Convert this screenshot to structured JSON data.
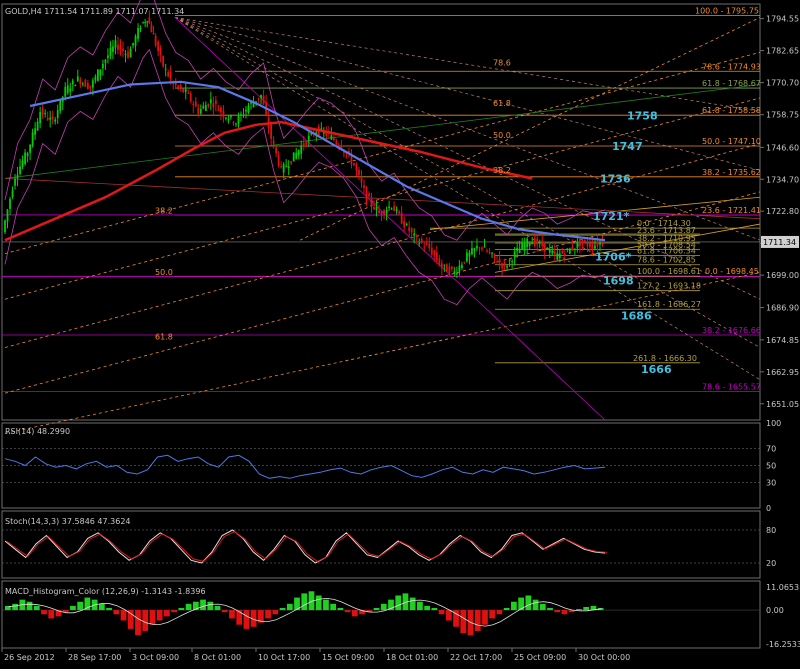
{
  "colors": {
    "background": "#000000",
    "frame": "#6e6e6e",
    "text": "#c8c8c8",
    "bull_candle": "#00d000",
    "bear_candle": "#e01010",
    "ma_red": "#e01818",
    "ma_blue": "#5a78e8",
    "bollinger": "#c040b0",
    "fib_orange": "#f08a2a",
    "fib_magenta": "#c000c0",
    "fib_olive": "#b0a040",
    "target_cyan": "#40c0e0",
    "rsi_line": "#4a7ae8",
    "stoch_main": "#e0e0e0",
    "stoch_signal": "#e01818",
    "macd_up": "#20d020",
    "macd_down": "#e01010"
  },
  "main": {
    "header": "GOLD,H4  1711.54 1711.89 1711.07 1711.34",
    "price_tag": "1711.34",
    "y_axis_ticks": [
      "1794.55",
      "1782.65",
      "1770.70",
      "1758.75",
      "1746.60",
      "1734.70",
      "1722.80",
      "1710.85",
      "1699.00",
      "1686.90",
      "1674.85",
      "1662.95",
      "1651.05"
    ],
    "fib_labels": [
      {
        "text": "100.0 - 1795.75",
        "kind": "orange"
      },
      {
        "text": "78.6 - 1774.93",
        "kind": "orange"
      },
      {
        "text": "61.8 - 1768.67",
        "kind": "green"
      },
      {
        "text": "61.8 - 1758.58",
        "kind": "orange"
      },
      {
        "text": "50.0 - 1747.10",
        "kind": "orange"
      },
      {
        "text": "38.2 - 1735.62",
        "kind": "orange"
      },
      {
        "text": "23.6 - 1721.41",
        "kind": "orange"
      },
      {
        "text": "0.0 - 1714.30",
        "kind": "olive"
      },
      {
        "text": "23.6 - 1713.87",
        "kind": "olive"
      },
      {
        "text": "38.2 - 1710.95",
        "kind": "olive"
      },
      {
        "text": "50.0 - 1708.54",
        "kind": "olive"
      },
      {
        "text": "61.8 - 1706.34",
        "kind": "olive"
      },
      {
        "text": "78.6 - 1702.85",
        "kind": "olive"
      },
      {
        "text": "100.0 - 1698.61",
        "kind": "olive"
      },
      {
        "text": "0.0 - 1698.45",
        "kind": "orange"
      },
      {
        "text": "127.2 - 1693.18",
        "kind": "olive"
      },
      {
        "text": "161.8 - 1686.27",
        "kind": "olive"
      },
      {
        "text": "38.2 - 1676.66",
        "kind": "magenta"
      },
      {
        "text": "261.8 - 1666.30",
        "kind": "olive"
      },
      {
        "text": "78.6 - 1655.57",
        "kind": "magenta"
      }
    ],
    "level_labels": [
      {
        "text": "78.6"
      },
      {
        "text": "61.8"
      },
      {
        "text": "50.0"
      },
      {
        "text": "38.2"
      },
      {
        "text": "38.2"
      },
      {
        "text": "50.0"
      },
      {
        "text": "61.8"
      }
    ],
    "target_labels": [
      {
        "text": "1758"
      },
      {
        "text": "1747"
      },
      {
        "text": "1736"
      },
      {
        "text": "1721*"
      },
      {
        "text": "1706*"
      },
      {
        "text": "1698"
      },
      {
        "text": "1686"
      },
      {
        "text": "1666"
      }
    ]
  },
  "rsi": {
    "header": "RSI(14) 48.2990",
    "ticks": [
      "100",
      "70",
      "50",
      "30",
      "0"
    ]
  },
  "stoch": {
    "header": "Stoch(14,3,3) 37.5846 47.3624",
    "ticks": [
      "80",
      "20"
    ]
  },
  "macd": {
    "header": "MACD_Histogram_Color (12,26,9)  -1.3143 -1.8396",
    "ticks": [
      "11.0653",
      "0.00",
      "-16.2533"
    ]
  },
  "x_axis_labels": [
    "26 Sep 2012",
    "28 Sep 17:00",
    "3 Oct 09:00",
    "8 Oct 01:00",
    "10 Oct 17:00",
    "15 Oct 09:00",
    "18 Oct 01:00",
    "22 Oct 17:00",
    "25 Oct 09:00",
    "30 Oct 00:00"
  ],
  "chart_data": {
    "type": "candlestick",
    "symbol": "GOLD",
    "timeframe": "H4",
    "ohlc_last": {
      "open": 1711.54,
      "high": 1711.89,
      "low": 1711.07,
      "close": 1711.34
    },
    "ylim": [
      1645,
      1800
    ],
    "path_points": [
      [
        0,
        1715
      ],
      [
        10,
        1736
      ],
      [
        20,
        1745
      ],
      [
        30,
        1760
      ],
      [
        40,
        1756
      ],
      [
        50,
        1768
      ],
      [
        60,
        1772
      ],
      [
        70,
        1769
      ],
      [
        80,
        1778
      ],
      [
        90,
        1785
      ],
      [
        100,
        1781
      ],
      [
        110,
        1792
      ],
      [
        115,
        1795
      ],
      [
        120,
        1788
      ],
      [
        128,
        1777
      ],
      [
        136,
        1770
      ],
      [
        146,
        1767
      ],
      [
        156,
        1760
      ],
      [
        166,
        1764
      ],
      [
        176,
        1759
      ],
      [
        186,
        1756
      ],
      [
        196,
        1762
      ],
      [
        206,
        1766
      ],
      [
        214,
        1750
      ],
      [
        222,
        1738
      ],
      [
        230,
        1742
      ],
      [
        240,
        1748
      ],
      [
        250,
        1753
      ],
      [
        260,
        1751
      ],
      [
        270,
        1747
      ],
      [
        280,
        1740
      ],
      [
        290,
        1728
      ],
      [
        300,
        1722
      ],
      [
        310,
        1725
      ],
      [
        320,
        1718
      ],
      [
        330,
        1712
      ],
      [
        340,
        1709
      ],
      [
        350,
        1702
      ],
      [
        360,
        1700
      ],
      [
        370,
        1706
      ],
      [
        380,
        1710
      ],
      [
        390,
        1706
      ],
      [
        400,
        1702
      ],
      [
        410,
        1708
      ],
      [
        420,
        1712
      ],
      [
        430,
        1710
      ],
      [
        440,
        1706
      ],
      [
        450,
        1708
      ],
      [
        460,
        1711
      ],
      [
        470,
        1710
      ],
      [
        478,
        1711.34
      ]
    ],
    "ma_red": [
      [
        0,
        1712
      ],
      [
        40,
        1720
      ],
      [
        80,
        1728
      ],
      [
        120,
        1738
      ],
      [
        150,
        1746
      ],
      [
        175,
        1752
      ],
      [
        200,
        1755
      ],
      [
        220,
        1756
      ],
      [
        240,
        1754
      ],
      [
        270,
        1751
      ],
      [
        300,
        1748
      ],
      [
        330,
        1745
      ],
      [
        355,
        1742
      ],
      [
        380,
        1739
      ],
      [
        400,
        1737
      ],
      [
        420,
        1735
      ]
    ],
    "ma_blue": [
      [
        20,
        1762
      ],
      [
        60,
        1766
      ],
      [
        100,
        1770
      ],
      [
        140,
        1771
      ],
      [
        170,
        1769
      ],
      [
        200,
        1763
      ],
      [
        230,
        1756
      ],
      [
        260,
        1748
      ],
      [
        290,
        1740
      ],
      [
        320,
        1732
      ],
      [
        350,
        1726
      ],
      [
        380,
        1720
      ],
      [
        410,
        1716
      ],
      [
        440,
        1714
      ],
      [
        478,
        1712
      ]
    ],
    "rsi_values": [
      58,
      55,
      50,
      60,
      52,
      48,
      50,
      46,
      52,
      55,
      48,
      50,
      42,
      40,
      45,
      60,
      62,
      55,
      58,
      60,
      52,
      48,
      60,
      62,
      55,
      40,
      35,
      37,
      35,
      38,
      40,
      42,
      45,
      47,
      42,
      40,
      45,
      48,
      50,
      44,
      38,
      36,
      40,
      45,
      48,
      42,
      40,
      45,
      42,
      48,
      46,
      44,
      40,
      42,
      45,
      48,
      50,
      46,
      47,
      48
    ],
    "stoch_main": [
      60,
      45,
      30,
      55,
      70,
      50,
      30,
      40,
      65,
      75,
      60,
      40,
      25,
      35,
      60,
      75,
      65,
      45,
      25,
      20,
      40,
      70,
      80,
      65,
      40,
      25,
      45,
      70,
      60,
      35,
      20,
      30,
      60,
      75,
      55,
      35,
      30,
      45,
      60,
      50,
      35,
      25,
      35,
      55,
      70,
      60,
      40,
      30,
      45,
      70,
      75,
      60,
      45,
      55,
      65,
      55,
      45,
      40,
      38
    ],
    "macd_hist": [
      2,
      3,
      5,
      4,
      2,
      -2,
      -4,
      -3,
      -1,
      2,
      4,
      6,
      5,
      3,
      1,
      -2,
      -5,
      -9,
      -12,
      -10,
      -7,
      -5,
      -3,
      -1,
      1,
      3,
      4,
      5,
      4,
      2,
      -1,
      -4,
      -7,
      -9,
      -8,
      -6,
      -4,
      -2,
      1,
      3,
      6,
      8,
      9,
      7,
      5,
      3,
      1,
      -1,
      -3,
      -2,
      -1,
      1,
      3,
      5,
      7,
      8,
      6,
      4,
      2,
      1,
      -2,
      -5,
      -8,
      -11,
      -12,
      -10,
      -7,
      -4,
      -2,
      1,
      4,
      6,
      7,
      5,
      3,
      1,
      -1,
      -2,
      -1,
      0.5,
      1.5,
      2,
      1
    ]
  }
}
